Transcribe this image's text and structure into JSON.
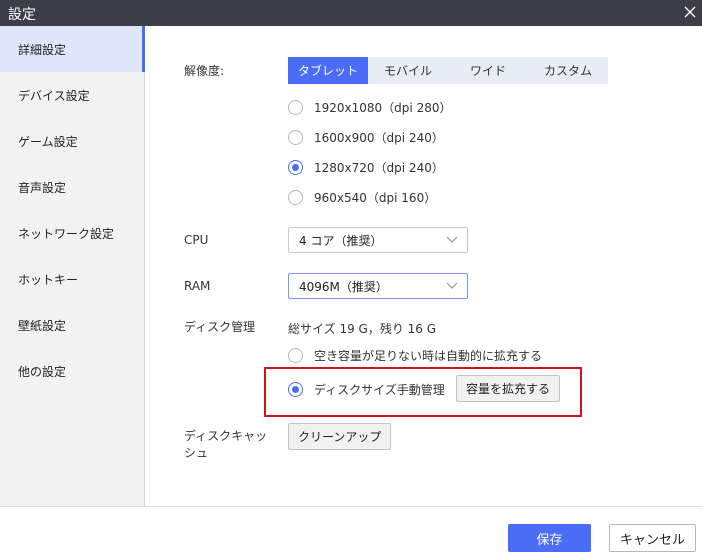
{
  "window": {
    "title": "設定"
  },
  "icons": {
    "close": "close-icon",
    "chevron": "chevron-down-icon"
  },
  "colors": {
    "accent": "#4a6cf7",
    "titlebar": "#3c3f4a",
    "highlight": "#d2131e"
  },
  "sidebar": {
    "items": [
      {
        "label": "詳細設定",
        "active": true
      },
      {
        "label": "デバイス設定",
        "active": false
      },
      {
        "label": "ゲーム設定",
        "active": false
      },
      {
        "label": "音声設定",
        "active": false
      },
      {
        "label": "ネットワーク設定",
        "active": false
      },
      {
        "label": "ホットキー",
        "active": false
      },
      {
        "label": "壁紙設定",
        "active": false
      },
      {
        "label": "他の設定",
        "active": false
      }
    ]
  },
  "resolution": {
    "label": "解像度:",
    "tabs": [
      {
        "label": "タブレット",
        "active": true
      },
      {
        "label": "モバイル",
        "active": false
      },
      {
        "label": "ワイド",
        "active": false
      },
      {
        "label": "カスタム",
        "active": false
      }
    ],
    "options": [
      {
        "label": "1920x1080（dpi 280）",
        "checked": false
      },
      {
        "label": "1600x900（dpi 240）",
        "checked": false
      },
      {
        "label": "1280x720（dpi 240）",
        "checked": true
      },
      {
        "label": "960x540（dpi 160）",
        "checked": false
      }
    ]
  },
  "cpu": {
    "label": "CPU",
    "value": "4 コア（推奨）"
  },
  "ram": {
    "label": "RAM",
    "value": "4096M（推奨）"
  },
  "disk": {
    "label": "ディスク管理",
    "summary": "総サイズ 19 G，残り 16 G",
    "options": [
      {
        "label": "空き容量が足りない時は自動的に拡充する",
        "checked": false
      },
      {
        "label": "ディスクサイズ手動管理",
        "checked": true
      }
    ],
    "expand_button": "容量を拡充する"
  },
  "disk_cache": {
    "label_line1": "ディスクキャッ",
    "label_line2": "シュ",
    "cleanup_button": "クリーンアップ"
  },
  "footer": {
    "save": "保存",
    "cancel": "キャンセル"
  }
}
